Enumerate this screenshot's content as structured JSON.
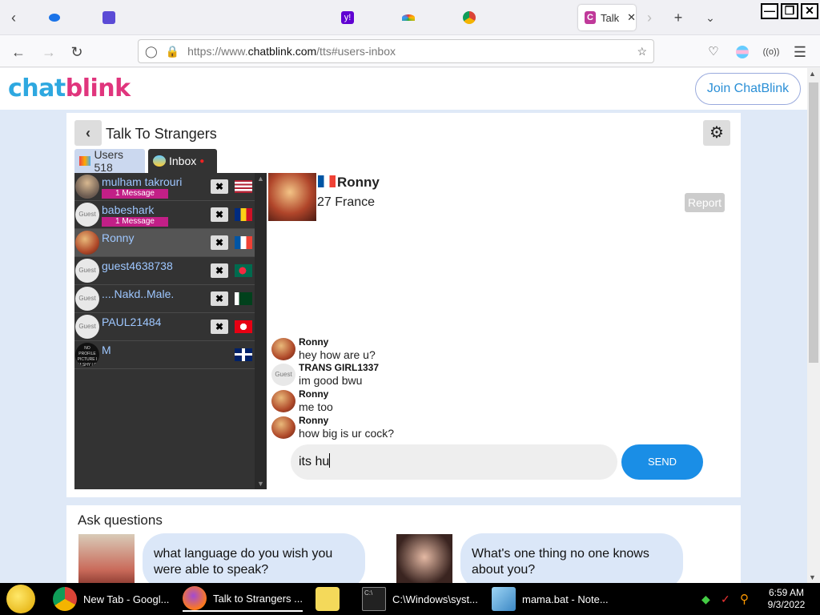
{
  "browser": {
    "active_tab_title": "Talk",
    "url_prefix": "https://www.",
    "url_domain": "chatblink.com",
    "url_suffix": "/tts#users-inbox"
  },
  "site": {
    "logo_part1": "chat",
    "logo_part2": "blink",
    "join_label": "Join ChatBlink"
  },
  "panel": {
    "title": "Talk To Strangers",
    "users_tab": "Users 518",
    "inbox_tab": "Inbox"
  },
  "inbox": [
    {
      "name": "mulham takrouri",
      "badge": "1 Message",
      "avatar": "man",
      "flag": "us",
      "closable": true
    },
    {
      "name": "babeshark",
      "badge": "1 Message",
      "avatar": "Guest",
      "flag": "ro",
      "closable": true
    },
    {
      "name": "Ronny",
      "badge": "",
      "avatar": "photo",
      "flag": "fr",
      "closable": true,
      "selected": true
    },
    {
      "name": "guest4638738",
      "badge": "",
      "avatar": "Guest",
      "flag": "bd",
      "closable": true
    },
    {
      "name": "....Nakd..Male.",
      "badge": "",
      "avatar": "Guest",
      "flag": "pk",
      "closable": true
    },
    {
      "name": "PAUL21484",
      "badge": "",
      "avatar": "Guest",
      "flag": "tn",
      "closable": true
    },
    {
      "name": "M",
      "badge": "",
      "avatar": "NO PROFILE PICTURE I AM SHY LOL",
      "flag": "gb",
      "closable": false
    }
  ],
  "chat": {
    "partner_name": "Ronny",
    "partner_meta": "27 France",
    "report_label": "Report",
    "messages": [
      {
        "sender": "Ronny",
        "text": "hey how are u?",
        "avatar": "photo"
      },
      {
        "sender": "TRANS GIRL1337",
        "text": "im good bwu",
        "avatar": "Guest"
      },
      {
        "sender": "Ronny",
        "text": "me too",
        "avatar": "photo"
      },
      {
        "sender": "Ronny",
        "text": "how big is ur cock?",
        "avatar": "photo"
      }
    ],
    "input_value": "its hu",
    "send_label": "SEND"
  },
  "ask": {
    "title": "Ask questions",
    "questions": [
      "what language do you wish you were able to speak?",
      "What's one thing no one knows about you?"
    ]
  },
  "taskbar": {
    "items": [
      "New Tab - Googl...",
      "Talk to Strangers ...",
      "C:\\Windows\\syst...",
      "mama.bat - Note..."
    ],
    "time": "6:59 AM",
    "date": "9/3/2022"
  },
  "colors": {
    "accent_blue": "#1a8ee6",
    "badge_pink": "#c21f87",
    "list_bg": "#333333"
  }
}
